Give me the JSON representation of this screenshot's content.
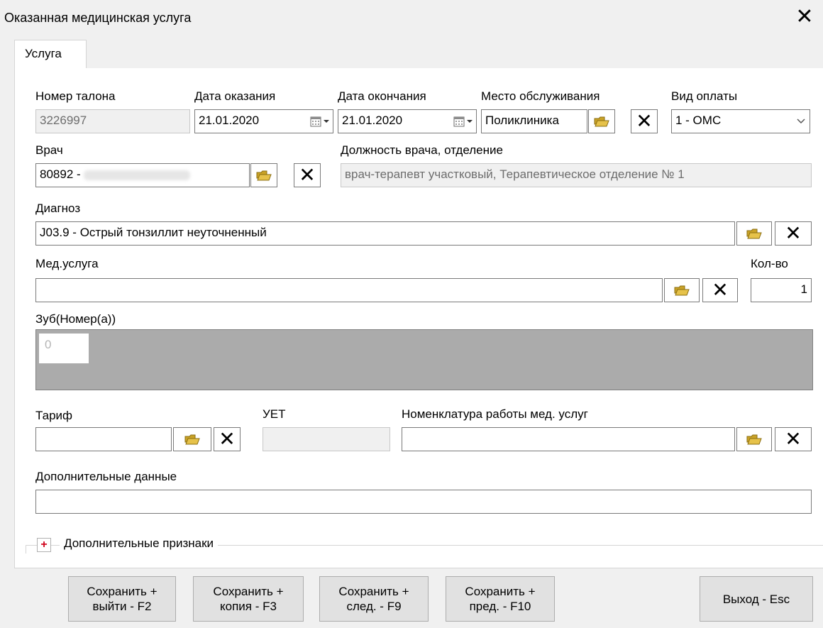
{
  "window": {
    "title": "Оказанная медицинская услуга",
    "close_glyph": "✕"
  },
  "tabs": [
    {
      "label": "Услуга",
      "active": true
    }
  ],
  "fields": {
    "ticket_number": {
      "label": "Номер талона",
      "value": "3226997"
    },
    "date_start": {
      "label": "Дата оказания",
      "value": "21.01.2020"
    },
    "date_end": {
      "label": "Дата окончания",
      "value": "21.01.2020"
    },
    "service_place": {
      "label": "Место обслуживания",
      "value": "Поликлиника"
    },
    "payment_type": {
      "label": "Вид оплаты",
      "value": "1 - ОМС"
    },
    "doctor": {
      "label": "Врач",
      "value": "80892 -"
    },
    "doctor_position": {
      "label": "Должность врача, отделение",
      "value": "врач-терапевт участковый, Терапевтическое отделение № 1"
    },
    "diagnosis": {
      "label": "Диагноз",
      "value": "J03.9 - Острый тонзиллит неуточненный"
    },
    "med_service": {
      "label": "Мед.услуга",
      "value": ""
    },
    "quantity": {
      "label": "Кол-во",
      "value": "1"
    },
    "teeth": {
      "label": "Зуб(Номер(а))",
      "tooth_value": "0"
    },
    "tariff": {
      "label": "Тариф",
      "value": ""
    },
    "uet": {
      "label": "УЕТ",
      "value": ""
    },
    "nomenclature": {
      "label": "Номенклатура работы мед. услуг",
      "value": ""
    },
    "extra_data": {
      "label": "Дополнительные данные",
      "value": ""
    }
  },
  "extra_signs": {
    "label": "Дополнительные признаки",
    "expander": "+"
  },
  "buttons": {
    "save_exit": "Сохранить +\nвыйти - F2",
    "save_copy": "Сохранить +\nкопия - F3",
    "save_next": "Сохранить +\nслед. - F9",
    "save_prev": "Сохранить +\nпред. - F10",
    "exit": "Выход - Esc"
  },
  "icons": {
    "select": "select-folder-icon",
    "clear": "clear-x-icon",
    "calendar": "calendar-icon",
    "dropdown": "chevron-down-icon"
  },
  "colors": {
    "teeth_area": "#ababab",
    "expander_plus": "#d0021b"
  }
}
